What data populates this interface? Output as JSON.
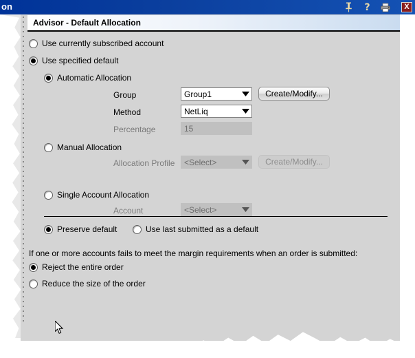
{
  "window": {
    "titlebar_text": "on",
    "icons": [
      {
        "name": "pin-icon",
        "glyph": "pin"
      },
      {
        "name": "help-icon",
        "glyph": "?"
      },
      {
        "name": "print-icon",
        "glyph": "printer"
      }
    ],
    "close_label": "X"
  },
  "panel": {
    "header_title": "Advisor - Default Allocation"
  },
  "options": {
    "use_subscribed": {
      "label": "Use currently subscribed account",
      "checked": false
    },
    "use_specified_default": {
      "label": "Use specified default",
      "checked": true
    },
    "automatic_allocation": {
      "label": "Automatic Allocation",
      "checked": true,
      "group_label": "Group",
      "group_value": "Group1",
      "method_label": "Method",
      "method_value": "NetLiq",
      "percentage_label": "Percentage",
      "percentage_value": "15",
      "create_modify_label": "Create/Modify..."
    },
    "manual_allocation": {
      "label": "Manual Allocation",
      "checked": false,
      "profile_label": "Allocation Profile",
      "profile_value": "<Select>",
      "create_modify_label": "Create/Modify..."
    },
    "single_account_allocation": {
      "label": "Single Account Allocation",
      "checked": false,
      "account_label": "Account",
      "account_value": "<Select>"
    }
  },
  "default_behavior": {
    "preserve_default": {
      "label": "Preserve default",
      "checked": true
    },
    "use_last_submitted": {
      "label": "Use last submitted as a default",
      "checked": false
    }
  },
  "margin_section": {
    "description": "If one or more accounts fails to meet the margin requirements when an order is submitted:",
    "reject_entire_order": {
      "label": "Reject the entire order",
      "checked": true
    },
    "reduce_size_of_order": {
      "label": "Reduce the size of the order",
      "checked": false
    }
  },
  "colors": {
    "titlebar": "#003399",
    "panel_bg": "#d4d4d4",
    "header_gradient_end": "#cadcf0",
    "close_button": "#8a1f1f"
  }
}
